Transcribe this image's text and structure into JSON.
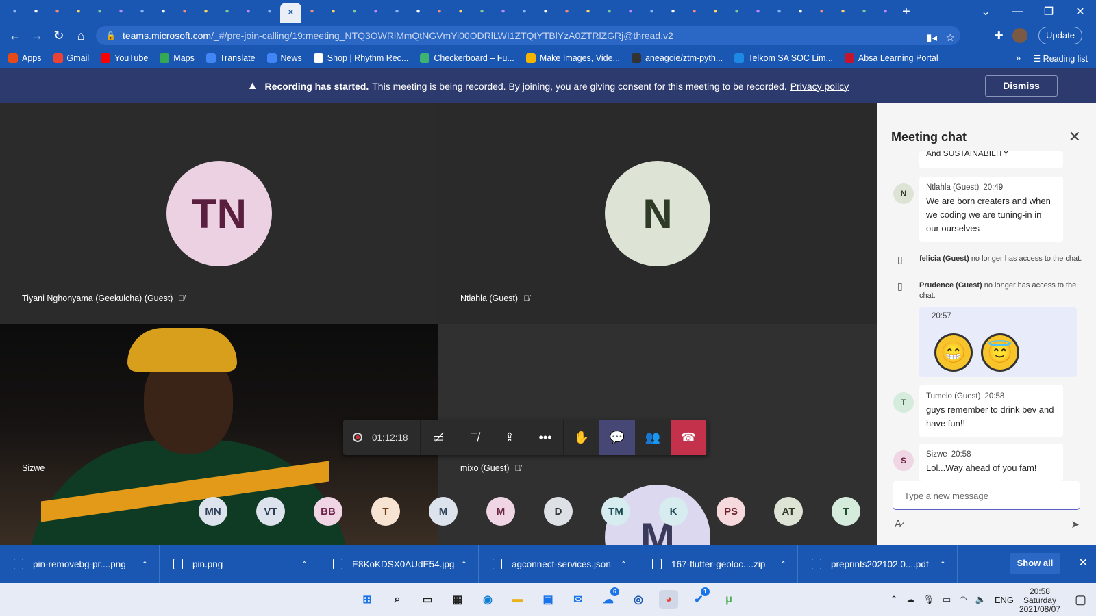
{
  "browser": {
    "tab_icons": [
      "flutter-icon",
      "flutter-icon",
      "photo-icon",
      "grid-icon",
      "google-icon",
      "fire-icon",
      "firebase-icon",
      "red-icon",
      "ms-icon",
      "figma-icon",
      "figma-icon",
      "gmail-icon",
      "gmail-icon",
      "teams-icon",
      "forms-icon",
      "udemy-icon",
      "app-icon",
      "docs-icon",
      "spark-icon",
      "gmail-icon",
      "shield-icon",
      "youtube-icon",
      "globe-icon",
      "globe-icon",
      "github-icon",
      "fire-icon",
      "fire-icon",
      "chrome-icon",
      "chrome-icon",
      "huawei-icon",
      "gitlab-icon",
      "github-icon",
      "google-icon",
      "bt-icon",
      "openai-icon",
      "github-icon",
      "github-icon",
      "twitter-icon",
      "slack-icon",
      "forms-icon",
      "forms-icon",
      "emoji-icon"
    ],
    "new_tab": "+",
    "url_host": "teams.microsoft.com",
    "url_path": "/_#/pre-join-calling/19:meeting_NTQ3OWRiMmQtNGVmYi00ODRlLWI1ZTQtYTBlYzA0ZTRlZGRj@thread.v2",
    "update_label": "Update",
    "bookmarks": [
      {
        "label": "Apps",
        "color": "#e64a19"
      },
      {
        "label": "Gmail",
        "color": "#ea4335"
      },
      {
        "label": "YouTube",
        "color": "#ff0000"
      },
      {
        "label": "Maps",
        "color": "#34a853"
      },
      {
        "label": "Translate",
        "color": "#4285f4"
      },
      {
        "label": "News",
        "color": "#4285f4"
      },
      {
        "label": "Shop | Rhythm Rec...",
        "color": "#ffffff"
      },
      {
        "label": "Checkerboard – Fu...",
        "color": "#3cb371"
      },
      {
        "label": "Make Images, Vide...",
        "color": "#f5b400"
      },
      {
        "label": "aneagoie/ztm-pyth...",
        "color": "#333333"
      },
      {
        "label": "Telkom SA SOC Lim...",
        "color": "#1e88e5"
      },
      {
        "label": "Absa Learning Portal",
        "color": "#c4152e"
      }
    ],
    "reading_list": "Reading list"
  },
  "banner": {
    "bold": "Recording has started.",
    "text": "This meeting is being recorded. By joining, you are giving consent for this meeting to be recorded.",
    "link": "Privacy policy",
    "dismiss": "Dismiss"
  },
  "participants": [
    {
      "initials": "TN",
      "name": "Tiyani Nghonyama (Geekulcha) (Guest)",
      "bg": "#ecd1e2",
      "fg": "#5a1f3e"
    },
    {
      "initials": "N",
      "name": "Ntlahla (Guest)",
      "bg": "#dde4d5",
      "fg": "#2f3a27"
    },
    {
      "initials": "",
      "name": "Sizwe",
      "bg": "",
      "fg": ""
    },
    {
      "initials": "M",
      "name": "mixo (Guest)",
      "bg": "#dcd8ef",
      "fg": "#3b3a5a"
    }
  ],
  "controls": {
    "timer": "01:12:18"
  },
  "roster": [
    {
      "initials": "MN",
      "bg": "#dce3ec",
      "fg": "#2c3d55"
    },
    {
      "initials": "VT",
      "bg": "#dce3ec",
      "fg": "#2c3d55"
    },
    {
      "initials": "BB",
      "bg": "#f0d6e4",
      "fg": "#6b2346"
    },
    {
      "initials": "T",
      "bg": "#f7e3d2",
      "fg": "#6b3e18"
    },
    {
      "initials": "M",
      "bg": "#dce3ec",
      "fg": "#2c3d55"
    },
    {
      "initials": "M",
      "bg": "#f0d6e4",
      "fg": "#6b2346"
    },
    {
      "initials": "D",
      "bg": "#dde1e6",
      "fg": "#2d3136"
    },
    {
      "initials": "TM",
      "bg": "#d7ecee",
      "fg": "#1f4c52"
    },
    {
      "initials": "K",
      "bg": "#d7ecee",
      "fg": "#1f4c52"
    },
    {
      "initials": "PS",
      "bg": "#f6d9dc",
      "fg": "#6b1f2a"
    },
    {
      "initials": "AT",
      "bg": "#dde4d5",
      "fg": "#2f3a27"
    },
    {
      "initials": "T",
      "bg": "#d5ebdc",
      "fg": "#1f4f30"
    }
  ],
  "chat": {
    "title": "Meeting chat",
    "partial": "And SUSTAINABILITY",
    "m1": {
      "initial": "N",
      "author": "Ntlahla (Guest)",
      "time": "20:49",
      "text": "We are born creaters and when we coding we are tuning-in in our ourselves"
    },
    "s1": {
      "bold": "felicia (Guest)",
      "text": "no longer has access to the chat."
    },
    "s2": {
      "bold": "Prudence (Guest)",
      "text": "no longer has access to the chat."
    },
    "mine_time": "20:57",
    "m2": {
      "initial": "T",
      "author": "Tumelo (Guest)",
      "time": "20:58",
      "text": "guys remember to drink bev and have fun!!"
    },
    "m3": {
      "initial": "S",
      "author": "Sizwe",
      "time": "20:58",
      "text": "Lol...Way ahead of you fam!"
    },
    "placeholder": "Type a new message"
  },
  "downloads": [
    "pin-removebg-pr....png",
    "pin.png",
    "E8KoKDSX0AUdE54.jpg",
    "agconnect-services.json",
    "167-flutter-geoloc....zip",
    "preprints202102.0....pdf"
  ],
  "show_all": "Show all",
  "taskbar": {
    "badge_whatsapp": "6",
    "badge_todo": "1",
    "lang": "ENG",
    "time": "20:58",
    "day": "Saturday",
    "date": "2021/08/07"
  }
}
